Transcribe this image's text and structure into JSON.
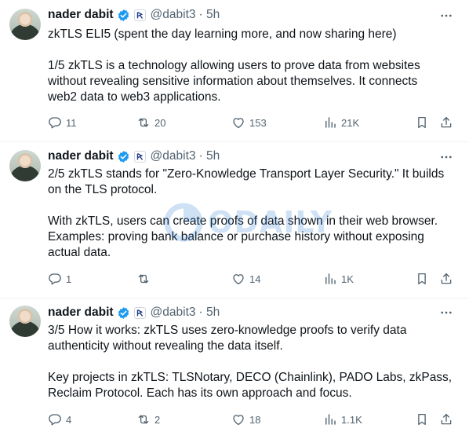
{
  "tweets": [
    {
      "name": "nader dabit",
      "handle": "@dabit3",
      "time": "· 5h",
      "lines": [
        "zkTLS ELI5 (spent the day learning more, and now sharing here)",
        "",
        "1/5 zkTLS is a technology allowing users to prove data from websites",
        "without revealing sensitive information about themselves. It connects",
        "web2 data to web3 applications."
      ],
      "replies": "11",
      "reposts": "20",
      "likes": "153",
      "views": "21K"
    },
    {
      "name": "nader dabit",
      "handle": "@dabit3",
      "time": "· 5h",
      "lines": [
        "2/5 zkTLS stands for \"Zero-Knowledge Transport Layer Security.\" It builds",
        "on the TLS protocol.",
        "",
        "With zkTLS, users can create proofs of data shown in their web browser.",
        "Examples: proving bank balance or purchase history without exposing",
        "actual data."
      ],
      "replies": "1",
      "reposts": "",
      "likes": "14",
      "views": "1K"
    },
    {
      "name": "nader dabit",
      "handle": "@dabit3",
      "time": "· 5h",
      "lines": [
        "3/5 How it works: zkTLS uses zero-knowledge proofs to verify data",
        "authenticity without revealing the data itself.",
        "",
        "Key projects in zkTLS: TLSNotary, DECO (Chainlink), PADO Labs, zkPass,",
        "Reclaim Protocol. Each has its own approach and focus."
      ],
      "replies": "4",
      "reposts": "2",
      "likes": "18",
      "views": "1.1K"
    }
  ],
  "watermark": "ODAILY",
  "colors": {
    "accent": "#1d9bf0",
    "text": "#0f1419",
    "secondary": "#536471",
    "divider": "#eff3f4"
  },
  "icons": [
    "verified-badge-icon",
    "affiliate-badge-icon",
    "more-icon",
    "reply-icon",
    "repost-icon",
    "like-icon",
    "views-icon",
    "bookmark-icon",
    "share-icon"
  ]
}
